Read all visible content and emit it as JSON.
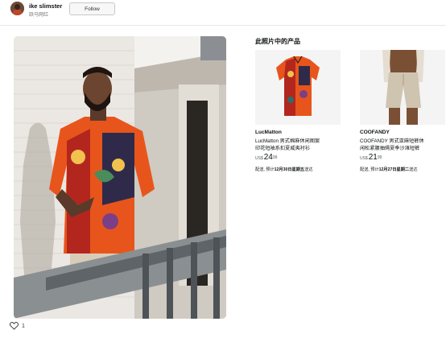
{
  "header": {
    "username": "ike slimster",
    "subtitle": "跃马网红",
    "follow_label": "Follow"
  },
  "post": {
    "photo_alt": "man in colorful patterned shirt leaning on railing",
    "like_count": "1"
  },
  "products_section": {
    "title": "此照片中的产品",
    "products": [
      {
        "brand": "LucMatton",
        "name_line1": "LucMatton 男式棉麻休闲图案",
        "name_line2": "印花短袖系扣夏威夷衬衫",
        "currency": "US$",
        "price_whole": "24",
        "price_fraction": "99",
        "delivery_prefix": "配送, 预计",
        "delivery_date": "12月30日星期五",
        "delivery_suffix": "送达"
      },
      {
        "brand": "COOFANDY",
        "name_line1": "COOFANDY 男式亚麻短裤休",
        "name_line2": "闲松紧腰抽绳夏季沙滩短裤",
        "currency": "US$",
        "price_whole": "21",
        "price_fraction": "99",
        "delivery_prefix": "配送, 预计",
        "delivery_date": "12月27日星期二",
        "delivery_suffix": "送达"
      }
    ]
  },
  "colors": {
    "text": "#0f1111",
    "muted": "#767676",
    "divider": "#e7e7e7",
    "shirt_orange": "#e8551c",
    "wall": "#e9e6e0"
  }
}
